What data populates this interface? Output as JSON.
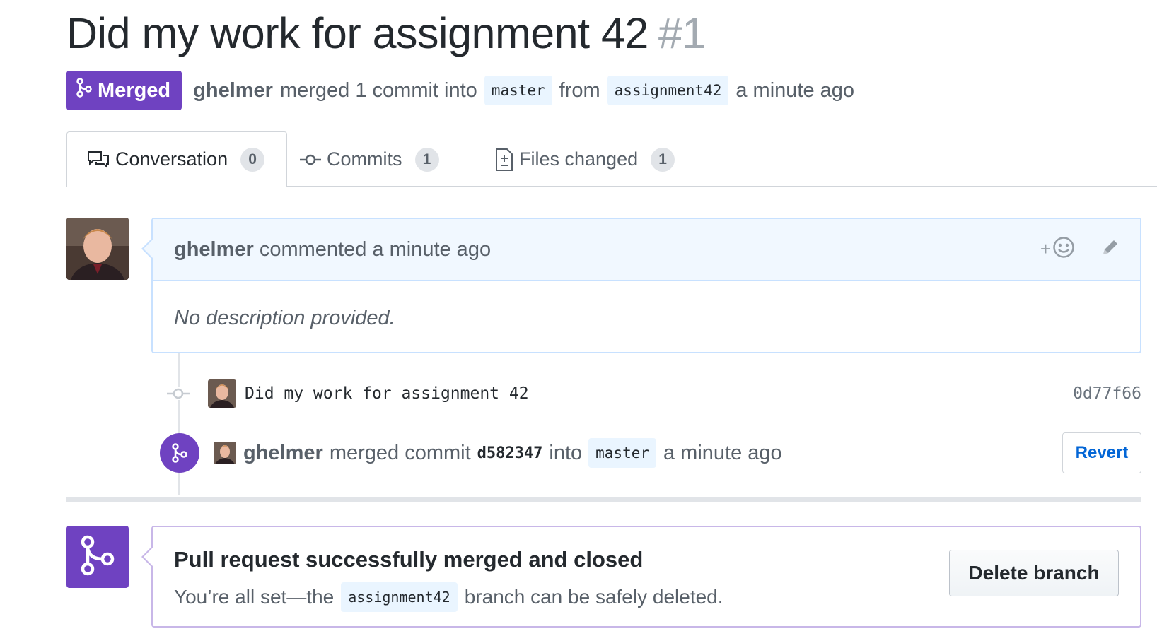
{
  "pr": {
    "title": "Did my work for assignment 42",
    "number": "#1",
    "state": "Merged",
    "author": "ghelmer",
    "merged_text": "merged 1 commit into",
    "base_branch": "master",
    "from_text": "from",
    "head_branch": "assignment42",
    "time": "a minute ago"
  },
  "tabs": [
    {
      "label": "Conversation",
      "count": "0",
      "icon": "comment-discussion-icon",
      "selected": true
    },
    {
      "label": "Commits",
      "count": "1",
      "icon": "git-commit-icon",
      "selected": false
    },
    {
      "label": "Files changed",
      "count": "1",
      "icon": "file-diff-icon",
      "selected": false
    }
  ],
  "comment": {
    "author": "ghelmer",
    "action": "commented a minute ago",
    "body": "No description provided.",
    "reaction_label": "+",
    "reaction_icon": "smiley-icon",
    "edit_icon": "pencil-icon"
  },
  "commit": {
    "message": "Did my work for assignment 42",
    "sha": "0d77f66"
  },
  "merge_event": {
    "author": "ghelmer",
    "text": "merged commit",
    "sha": "d582347",
    "into_text": "into",
    "branch": "master",
    "time": "a minute ago",
    "revert_label": "Revert"
  },
  "merge_status": {
    "title": "Pull request successfully merged and closed",
    "desc_prefix": "You’re all set—the",
    "branch": "assignment42",
    "desc_suffix": "branch can be safely deleted.",
    "delete_label": "Delete branch"
  },
  "colors": {
    "merged_purple": "#6f42c1",
    "link_blue": "#0366d6",
    "comment_header_bg": "#f1f8ff",
    "comment_border": "#c8e1ff",
    "ref_bg": "#eaf5ff"
  }
}
